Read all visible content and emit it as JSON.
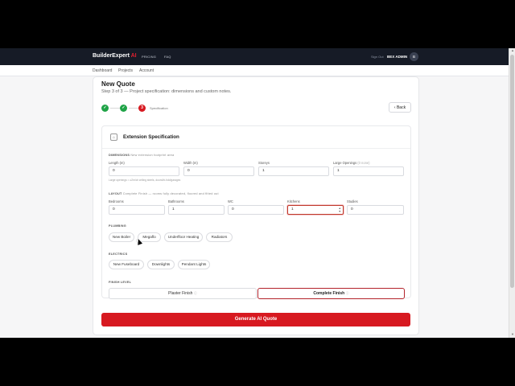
{
  "topbar": {
    "brand_main": "BuilderExpert",
    "brand_ai": "AI",
    "nav": [
      "PRICING",
      "FAQ"
    ],
    "sign_out": "Sign Out",
    "user_name": "BEX ADMIN",
    "avatar_initial": "B"
  },
  "subnav": [
    "Dashboard",
    "Projects",
    "Account"
  ],
  "page": {
    "title": "New Quote",
    "subtitle": "Step 3 of 3 — Project specification: dimensions and custom notes.",
    "steps": [
      {
        "label": "✓",
        "state": "done"
      },
      {
        "label": "✓",
        "state": "done"
      },
      {
        "label": "3",
        "state": "active"
      }
    ],
    "step_label": "Specification",
    "back_label": "Back"
  },
  "card": {
    "title": "Extension Specification",
    "dimensions": {
      "heading": "DIMENSIONS",
      "hint": "New extension footprint area",
      "fields": [
        {
          "label": "Length (m)",
          "value": "0"
        },
        {
          "label": "Width (m)",
          "value": "0"
        },
        {
          "label": "Storeys",
          "value": "1"
        },
        {
          "label": "Large Openings",
          "label_hint": "(0 none)",
          "value": "1"
        }
      ],
      "note": "Large openings = ≥2m/dr ceiling steels, doors/bi-fold/garages"
    },
    "layout": {
      "heading": "LAYOUT",
      "hint": "Complete Finish — rooms fully decorated, floored and fitted out",
      "fields": [
        {
          "label": "Bedrooms",
          "value": "0"
        },
        {
          "label": "Bathrooms",
          "value": "1"
        },
        {
          "label": "WC",
          "value": "0"
        },
        {
          "label": "Kitchens",
          "value": "1"
        },
        {
          "label": "Studies",
          "value": "0"
        }
      ]
    },
    "plumbing": {
      "heading": "PLUMBING",
      "chips": [
        "New Boiler",
        "Megaflo",
        "Underfloor Heating",
        "Radiators"
      ]
    },
    "electrics": {
      "heading": "ELECTRICS",
      "chips": [
        "New Fuseboard",
        "Downlights",
        "Pendant Lights"
      ]
    },
    "finish": {
      "heading": "FINISH LEVEL",
      "options": [
        "Plaster Finish",
        "Complete Finish"
      ],
      "selected": "Complete Finish",
      "info_icon": "ⓘ"
    }
  },
  "generate_label": "Generate AI Quote",
  "colors": {
    "accent": "#d71920",
    "success": "#1fa347",
    "navbar": "#161b26"
  }
}
